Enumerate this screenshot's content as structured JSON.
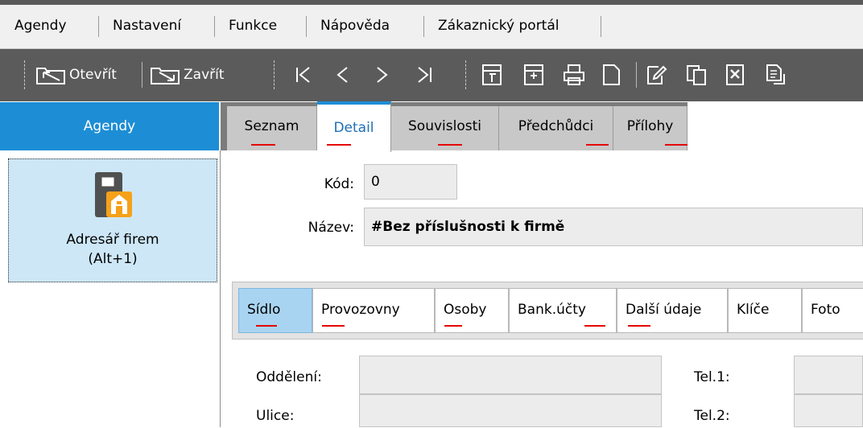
{
  "menu": {
    "items": [
      "Agendy",
      "Nastavení",
      "Funkce",
      "Nápověda",
      "Zákaznický portál"
    ]
  },
  "toolbar": {
    "open_label": "Otevřít",
    "close_label": "Zavřít",
    "icons": [
      "first-record-icon",
      "prev-record-icon",
      "next-record-icon",
      "last-record-icon",
      "copy-record-icon",
      "paste-record-icon",
      "print-icon",
      "new-document-icon",
      "edit-icon",
      "duplicate-icon",
      "delete-icon",
      "report-icon"
    ]
  },
  "sidebar": {
    "header": "Agendy",
    "item_name": "Adresář firem",
    "item_shortcut": "(Alt+1)"
  },
  "tabs": [
    "Seznam",
    "Detail",
    "Souvislosti",
    "Předchůdci",
    "Přílohy"
  ],
  "active_tab": "Detail",
  "form": {
    "kod_label": "Kód:",
    "kod_value": "0",
    "nazev_label": "Název:",
    "nazev_value": "#Bez příslušnosti k firmě"
  },
  "subtabs": [
    "Sídlo",
    "Provozovny",
    "Osoby",
    "Bank.účty",
    "Další údaje",
    "Klíče",
    "Foto"
  ],
  "active_subtab": "Sídlo",
  "address": {
    "oddeleni_label": "Oddělení:",
    "ulice_label": "Ulice:",
    "tel1_label": "Tel.1:",
    "tel2_label": "Tel.2:"
  },
  "colors": {
    "accent": "#1d8ed5",
    "toolbar_bg": "#5b5b5b",
    "menu_bg": "#f0f0f0",
    "active_subtab": "#a9d4f1",
    "underline": "#e60000"
  }
}
